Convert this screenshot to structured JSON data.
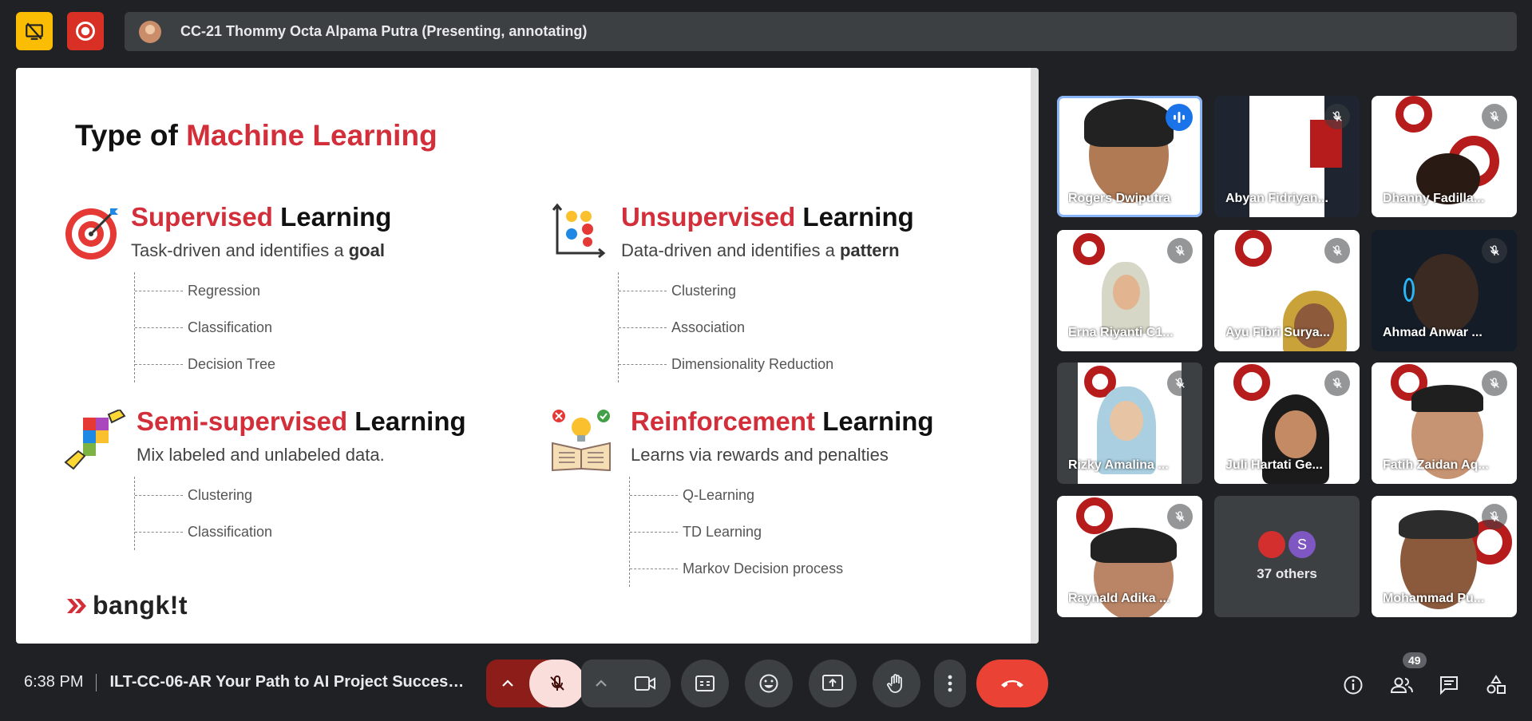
{
  "top": {
    "presenter_label": "CC-21 Thommy Octa Alpama Putra (Presenting, annotating)"
  },
  "slide": {
    "title_prefix": "Type of",
    "title_highlight": "Machine Learning",
    "quadrants": [
      {
        "highlight": "Supervised",
        "rest": "Learning",
        "desc_plain": "Task-driven and identifies a",
        "desc_bold": "goal",
        "items": [
          "Regression",
          "Classification",
          "Decision Tree"
        ]
      },
      {
        "highlight": "Unsupervised",
        "rest": "Learning",
        "desc_plain": "Data-driven and identifies a",
        "desc_bold": "pattern",
        "items": [
          "Clustering",
          "Association",
          "Dimensionality Reduction"
        ]
      },
      {
        "highlight": "Semi-supervised",
        "rest": "Learning",
        "desc_plain": "Mix labeled and unlabeled data.",
        "desc_bold": "",
        "items": [
          "Clustering",
          "Classification"
        ]
      },
      {
        "highlight": "Reinforcement",
        "rest": "Learning",
        "desc_plain": "Learns via rewards and penalties",
        "desc_bold": "",
        "items": [
          "Q-Learning",
          "TD Learning",
          "Markov Decision process"
        ]
      }
    ],
    "logo_text": "bangk!t"
  },
  "participants": [
    {
      "name": "Rogers Dwiputra"
    },
    {
      "name": "Abyan Fidriyan..."
    },
    {
      "name": "Dhanny Fadilla..."
    },
    {
      "name": "Erna Riyanti C1..."
    },
    {
      "name": "Ayu Fibri Surya..."
    },
    {
      "name": "Ahmad Anwar ..."
    },
    {
      "name": "Rizky Amalina ..."
    },
    {
      "name": "Juli Hartati Ge..."
    },
    {
      "name": "Fatih Zaidan Aq..."
    },
    {
      "name": "Raynald Adika ..."
    },
    {
      "name": "37 others",
      "avatar_letter": "S"
    },
    {
      "name": "Mohammad Pu..."
    }
  ],
  "bottom": {
    "time": "6:38 PM",
    "meeting_title": "ILT-CC-06-AR Your Path to AI Project Success...",
    "people_count": "49"
  },
  "colors": {
    "accent_red": "#d32f3a",
    "end_call": "#ea4335",
    "active_outline": "#8ab4f8"
  }
}
